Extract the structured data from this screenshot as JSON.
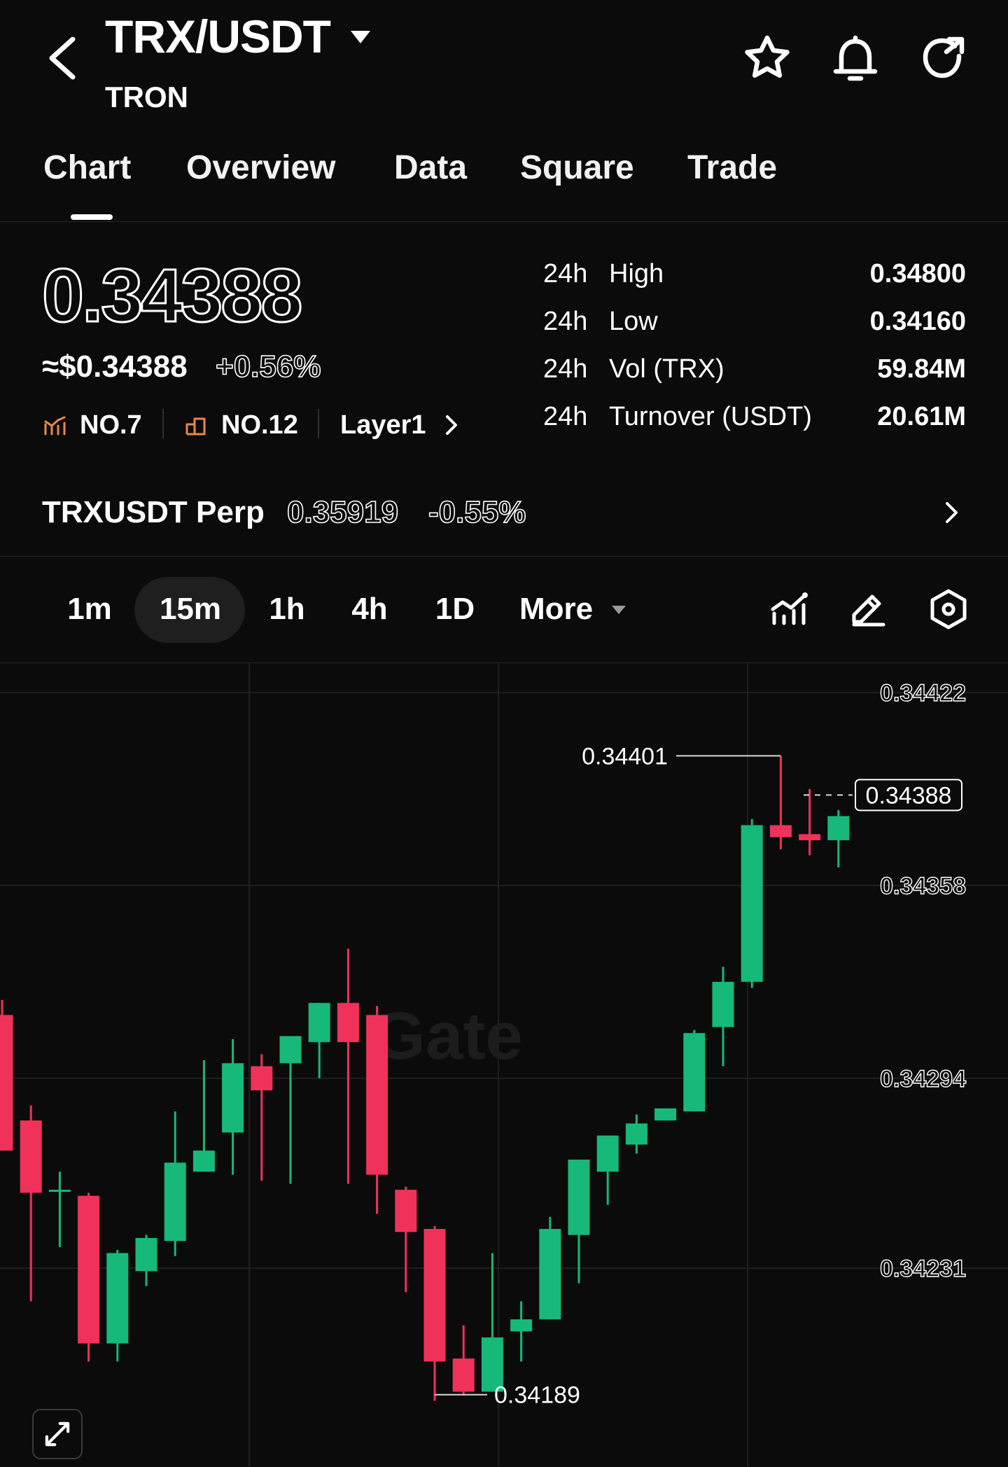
{
  "header": {
    "pair": "TRX/USDT",
    "name": "TRON",
    "icons": [
      "back-icon",
      "caret-down-icon",
      "star-icon",
      "bell-icon",
      "share-icon"
    ]
  },
  "tabs": [
    {
      "label": "Chart",
      "active": true
    },
    {
      "label": "Overview"
    },
    {
      "label": "Data"
    },
    {
      "label": "Square"
    },
    {
      "label": "Trade"
    }
  ],
  "price": {
    "last": "0.34388",
    "usd": "≈$0.34388",
    "change": "+0.56%",
    "ranks": [
      {
        "icon": "market-cap-icon",
        "label": "NO.7"
      },
      {
        "icon": "volume-icon",
        "label": "NO.12"
      }
    ],
    "category": "Layer1"
  },
  "stats": [
    {
      "period": "24h",
      "label": "High",
      "value": "0.34800"
    },
    {
      "period": "24h",
      "label": "Low",
      "value": "0.34160"
    },
    {
      "period": "24h",
      "label": "Vol (TRX)",
      "value": "59.84M"
    },
    {
      "period": "24h",
      "label": "Turnover (USDT)",
      "value": "20.61M"
    }
  ],
  "perp": {
    "label": "TRXUSDT Perp",
    "price": "0.35919",
    "change": "-0.55%"
  },
  "intervals": [
    {
      "label": "1m"
    },
    {
      "label": "15m",
      "active": true
    },
    {
      "label": "1h"
    },
    {
      "label": "4h"
    },
    {
      "label": "1D"
    },
    {
      "label": "More"
    }
  ],
  "toolbar_icons": [
    "indicators-icon",
    "draw-icon",
    "settings-icon"
  ],
  "colors": {
    "up": "#16b979",
    "down": "#f0325a",
    "background": "#0b0b0b"
  },
  "chart_data": {
    "type": "candlestick",
    "interval": "15m",
    "watermark": "Gate",
    "y_ticks": [
      "0.34422",
      "0.34358",
      "0.34294",
      "0.34231"
    ],
    "current_price": "0.34388",
    "high_label": "0.34401",
    "low_label": "0.34189",
    "ylim": [
      0.34165,
      0.34432
    ],
    "candles": [
      {
        "o": 0.34315,
        "h": 0.3432,
        "l": 0.3427,
        "c": 0.3427
      },
      {
        "o": 0.3428,
        "h": 0.34285,
        "l": 0.3422,
        "c": 0.34256
      },
      {
        "o": 0.34257,
        "h": 0.34263,
        "l": 0.34238,
        "c": 0.34257
      },
      {
        "o": 0.34255,
        "h": 0.34256,
        "l": 0.342,
        "c": 0.34206
      },
      {
        "o": 0.34206,
        "h": 0.34237,
        "l": 0.342,
        "c": 0.34236
      },
      {
        "o": 0.3423,
        "h": 0.34242,
        "l": 0.34225,
        "c": 0.34241
      },
      {
        "o": 0.3424,
        "h": 0.34283,
        "l": 0.34235,
        "c": 0.34266
      },
      {
        "o": 0.34263,
        "h": 0.343,
        "l": 0.34263,
        "c": 0.3427
      },
      {
        "o": 0.34276,
        "h": 0.34307,
        "l": 0.34262,
        "c": 0.34299
      },
      {
        "o": 0.34298,
        "h": 0.34302,
        "l": 0.3426,
        "c": 0.3429
      },
      {
        "o": 0.34299,
        "h": 0.34302,
        "l": 0.34259,
        "c": 0.34308
      },
      {
        "o": 0.34306,
        "h": 0.34319,
        "l": 0.34294,
        "c": 0.34319
      },
      {
        "o": 0.34319,
        "h": 0.34337,
        "l": 0.34259,
        "c": 0.34306
      },
      {
        "o": 0.34315,
        "h": 0.34318,
        "l": 0.34249,
        "c": 0.34262
      },
      {
        "o": 0.34257,
        "h": 0.34258,
        "l": 0.34223,
        "c": 0.34243
      },
      {
        "o": 0.34244,
        "h": 0.34245,
        "l": 0.34187,
        "c": 0.342
      },
      {
        "o": 0.34201,
        "h": 0.34212,
        "l": 0.34189,
        "c": 0.3419
      },
      {
        "o": 0.3419,
        "h": 0.34236,
        "l": 0.3419,
        "c": 0.34208
      },
      {
        "o": 0.3421,
        "h": 0.3422,
        "l": 0.342,
        "c": 0.34214
      },
      {
        "o": 0.34214,
        "h": 0.34248,
        "l": 0.34214,
        "c": 0.34244
      },
      {
        "o": 0.34242,
        "h": 0.34256,
        "l": 0.34226,
        "c": 0.34267
      },
      {
        "o": 0.34263,
        "h": 0.34266,
        "l": 0.34252,
        "c": 0.34275
      },
      {
        "o": 0.34272,
        "h": 0.34282,
        "l": 0.34269,
        "c": 0.34279
      },
      {
        "o": 0.3428,
        "h": 0.34283,
        "l": 0.3428,
        "c": 0.34284
      },
      {
        "o": 0.34283,
        "h": 0.3431,
        "l": 0.34283,
        "c": 0.34309
      },
      {
        "o": 0.34311,
        "h": 0.34331,
        "l": 0.34298,
        "c": 0.34326
      },
      {
        "o": 0.34326,
        "h": 0.3438,
        "l": 0.34324,
        "c": 0.34378
      },
      {
        "o": 0.34378,
        "h": 0.34401,
        "l": 0.3437,
        "c": 0.34374
      },
      {
        "o": 0.34375,
        "h": 0.3439,
        "l": 0.34368,
        "c": 0.34373
      },
      {
        "o": 0.34373,
        "h": 0.34383,
        "l": 0.34364,
        "c": 0.34381
      },
      {
        "o": 0.34388,
        "h": 0.34388,
        "l": 0.34388,
        "c": 0.34388
      }
    ]
  }
}
